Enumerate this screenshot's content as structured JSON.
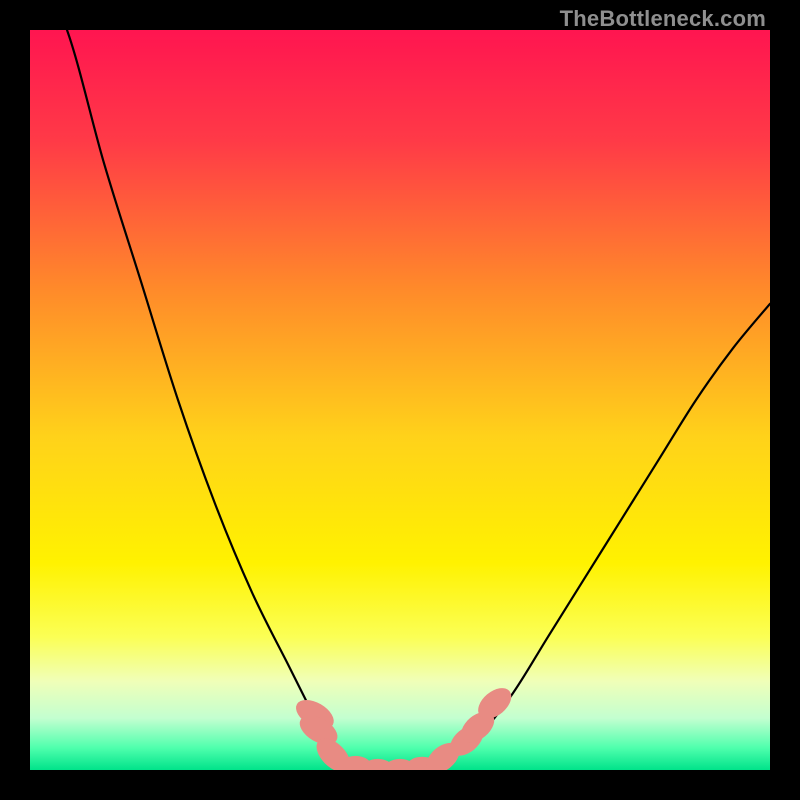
{
  "watermark": {
    "text": "TheBottleneck.com"
  },
  "gradient": {
    "stops": [
      {
        "offset": 0.0,
        "color": "#ff1550"
      },
      {
        "offset": 0.15,
        "color": "#ff3a47"
      },
      {
        "offset": 0.35,
        "color": "#ff8a2a"
      },
      {
        "offset": 0.55,
        "color": "#ffd21a"
      },
      {
        "offset": 0.72,
        "color": "#fff200"
      },
      {
        "offset": 0.82,
        "color": "#fbff55"
      },
      {
        "offset": 0.88,
        "color": "#f0ffb8"
      },
      {
        "offset": 0.93,
        "color": "#c3ffd0"
      },
      {
        "offset": 0.97,
        "color": "#4fffad"
      },
      {
        "offset": 1.0,
        "color": "#00e38a"
      }
    ]
  },
  "chart_data": {
    "type": "line",
    "title": "",
    "xlabel": "",
    "ylabel": "",
    "xlim": [
      0,
      100
    ],
    "ylim": [
      0,
      100
    ],
    "categories": [
      0,
      5,
      10,
      15,
      20,
      25,
      30,
      35,
      38,
      40,
      43,
      46,
      49,
      52,
      55,
      60,
      65,
      70,
      75,
      80,
      85,
      90,
      95,
      100
    ],
    "series": [
      {
        "name": "bottleneck-curve",
        "values": [
          110,
          100,
          82,
          66,
          50,
          36,
          24,
          14,
          8,
          4,
          1,
          0,
          0,
          0,
          1,
          4,
          10,
          18,
          26,
          34,
          42,
          50,
          57,
          63
        ]
      }
    ],
    "markers": [
      {
        "x": 38.5,
        "y": 7.5,
        "rx": 1.6,
        "ry": 2.8,
        "angle": -60
      },
      {
        "x": 39.0,
        "y": 5.4,
        "rx": 1.6,
        "ry": 2.8,
        "angle": -60
      },
      {
        "x": 41.0,
        "y": 2.0,
        "rx": 1.6,
        "ry": 2.8,
        "angle": -45
      },
      {
        "x": 44.0,
        "y": 0.4,
        "rx": 2.2,
        "ry": 1.5,
        "angle": 0
      },
      {
        "x": 47.0,
        "y": 0.0,
        "rx": 2.2,
        "ry": 1.5,
        "angle": 0
      },
      {
        "x": 50.0,
        "y": 0.0,
        "rx": 2.2,
        "ry": 1.5,
        "angle": 0
      },
      {
        "x": 53.0,
        "y": 0.3,
        "rx": 2.2,
        "ry": 1.5,
        "angle": 0
      },
      {
        "x": 55.8,
        "y": 1.6,
        "rx": 1.6,
        "ry": 2.6,
        "angle": 50
      },
      {
        "x": 59.0,
        "y": 4.0,
        "rx": 1.6,
        "ry": 2.6,
        "angle": 50
      },
      {
        "x": 60.5,
        "y": 5.8,
        "rx": 1.6,
        "ry": 2.6,
        "angle": 50
      },
      {
        "x": 62.8,
        "y": 9.0,
        "rx": 1.6,
        "ry": 2.6,
        "angle": 50
      }
    ],
    "marker_color": "#e88b83"
  }
}
